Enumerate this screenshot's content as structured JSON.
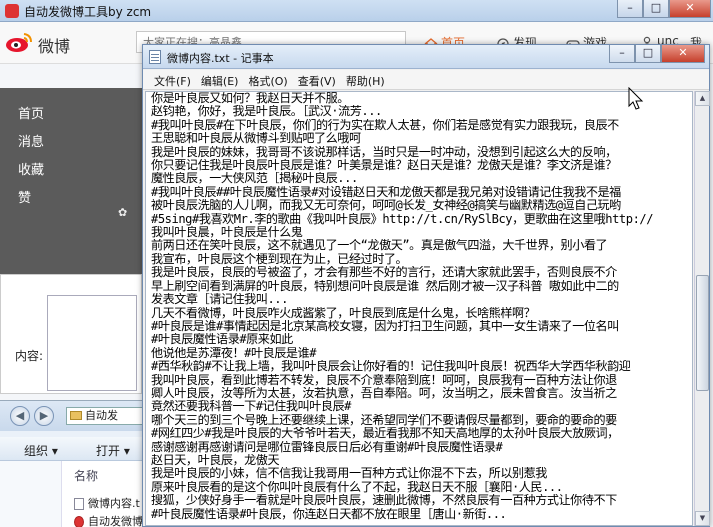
{
  "tool_window": {
    "title": "自动发微博工具by zcm",
    "brand": "微博",
    "search_placeholder": "大家正在搜：高晶鑫",
    "nav": [
      {
        "label": "首页",
        "icon": "home-icon"
      },
      {
        "label": "发现",
        "icon": "discover-icon"
      },
      {
        "label": "游戏",
        "icon": "game-icon"
      },
      {
        "label": "unc",
        "icon": "user-icon"
      },
      {
        "label": "我",
        "icon": ""
      }
    ],
    "sidebar": [
      {
        "label": "首页"
      },
      {
        "label": "消息"
      },
      {
        "label": "收藏"
      },
      {
        "label": "赞"
      }
    ],
    "content_label": "内容:"
  },
  "explorer": {
    "address": "自动发",
    "toolbar": {
      "organize": "组织 ▾",
      "open": "打开 ▾"
    },
    "column_header": "名称",
    "files": [
      {
        "name": "微博内容.t",
        "icon": "text-file-icon"
      },
      {
        "name": "自动发微博",
        "icon": "app-icon"
      }
    ]
  },
  "notepad": {
    "title": "微博内容.txt - 记事本",
    "menu": [
      "文件(F)",
      "编辑(E)",
      "格式(O)",
      "查看(V)",
      "帮助(H)"
    ],
    "lines": [
      "你是叶良辰又如何？我赵日天并不服。",
      "赵钧艳，你好，我是叶良辰。［武汉·流芳...",
      "#我叫叶良辰#在下叶良辰，你们的行为实在欺人太甚，你们若是感觉有实力跟我玩，良辰不",
      "王思聪和叶良辰从微博斗到贴吧了么哦呵",
      "我是叶良辰的妹妹，我哥哥不该说那样话，当时只是一时冲动，没想到引起这么大的反响，",
      "你只要记住我是叶良辰叶良辰是谁？叶美景是谁？赵日天是谁？龙傲天是谁？李文济是谁？",
      "魔性良辰，一大侠风范［揭秘叶良辰...",
      "#我叫叶良辰##叶良辰魔性语录#对设错赵日天和龙傲天都是我兄弟对设错请记住我我不是福",
      "被叶良辰洗脑的人儿啊，而我又无可奈何，呵呵@长发_女神经@搞笑与幽默精选@逗自己玩哟",
      "#5sing#我喜欢Mr.李的歌曲《我叫叶良辰》http://t.cn/RySlBcy，更歌曲在这里哦http://",
      "我叫叶良晨，叶良辰是什么鬼",
      "前两日还在笑叶良辰，这不就遇见了一个“龙傲天”。真是傲气四溢，大千世界，别小看了",
      "我宣布，叶良辰这个梗到现在为止，已经过时了。",
      "我是叶良辰，良辰的号被盗了，才会有那些不好的言行，还请大家就此罢手，否则良辰不介",
      "早上刷空间看到满屏的叶良辰，特别想问叶良辰是谁 然后刚才被一汉子科普 嗷如此中二的",
      "发表文章［请记住我叫...",
      "几天不看微博，叶良辰咋火成酱紫了，叶良辰到底是什么鬼，长啥熊样啊？",
      "#叶良辰是谁#事情起因是北京某高校女寝，因为打扫卫生问题，其中一女生请来了一位名叫",
      "#叶良辰魔性语录#原来如此",
      "他说他是苏潭夜！#叶良辰是谁#",
      "#西华秋韵#不让我上墙，我叫叶良辰会让你好看的！记住我叫叶良辰！祝西华大学西华秋韵迎",
      "我叫叶良辰，看到此博若不转发，良辰不介意奉陪到底！呵呵，良辰我有一百种方法让你退",
      "卿人叶良辰，汝等所为太甚，汝若执意，吾自奉陪。呵，汝当明之，辰未曾食言。汝当祈之",
      "竟然还要我科普一下#记住我叫叶良辰#",
      "哪个天三的到三个号晚上还要继续上课，还希望同学们不要请假尽量都到，要命的要命的要",
      "#网红四少#我是叶良辰的大爷爷叶若天，最近看我那不知天高地厚的太孙叶良辰大放厥词，",
      "感谢感谢再感谢请问是哪位雷锋良辰日后必有重谢#叶良辰魔性语录#",
      "赵日天，叶良辰，龙傲天",
      "我是叶良辰的小妹，信不信我让我哥用一百种方式让你混不下去，所以别惹我",
      "原来叶良辰看的是这个你叫叶良辰有什么了不起，我赵日天不服［襄阳·人民...",
      "搜狐，少侠好身手一看就是叶良辰叶良辰，速删此微博，不然良辰有一百种方式让你待不下",
      "#叶良辰魔性语录#叶良辰，你连赵日天都不放在眼里［唐山·新街..."
    ]
  }
}
